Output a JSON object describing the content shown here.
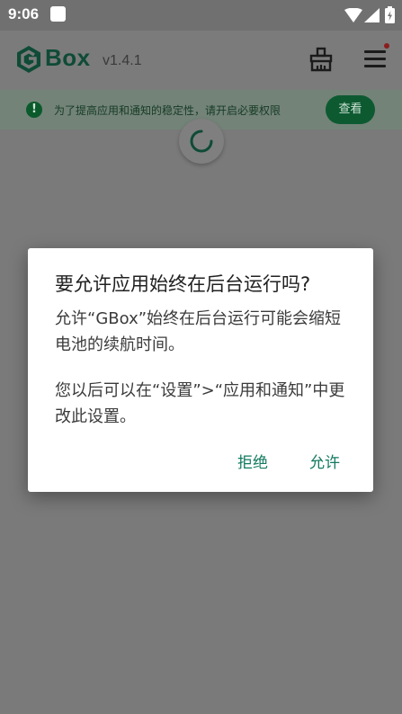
{
  "status_bar": {
    "time": "9:06",
    "icons": [
      "notification-icon",
      "wifi-icon",
      "cell-signal-icon",
      "battery-icon"
    ]
  },
  "app_bar": {
    "brand": "Box",
    "version": "v1.4.1",
    "icons": [
      "gbox-logo-icon",
      "cleaning-brush-icon",
      "hamburger-menu-icon"
    ]
  },
  "banner": {
    "text": "为了提高应用和通知的稳定性，请开启必要权限",
    "button_label": "查看",
    "icon": "warning-icon"
  },
  "dialog": {
    "title": "要允许应用始终在后台运行吗?",
    "message_1": "允许“GBox”始终在后台运行可能会缩短电池的续航时间。",
    "message_2": "您以后可以在“设置”>“应用和通知”中更改此设置。",
    "deny_label": "拒绝",
    "allow_label": "允许"
  },
  "colors": {
    "brand_green": "#0f4b36",
    "accent_teal": "#127a5f",
    "scrim": "#7a7a7a"
  }
}
